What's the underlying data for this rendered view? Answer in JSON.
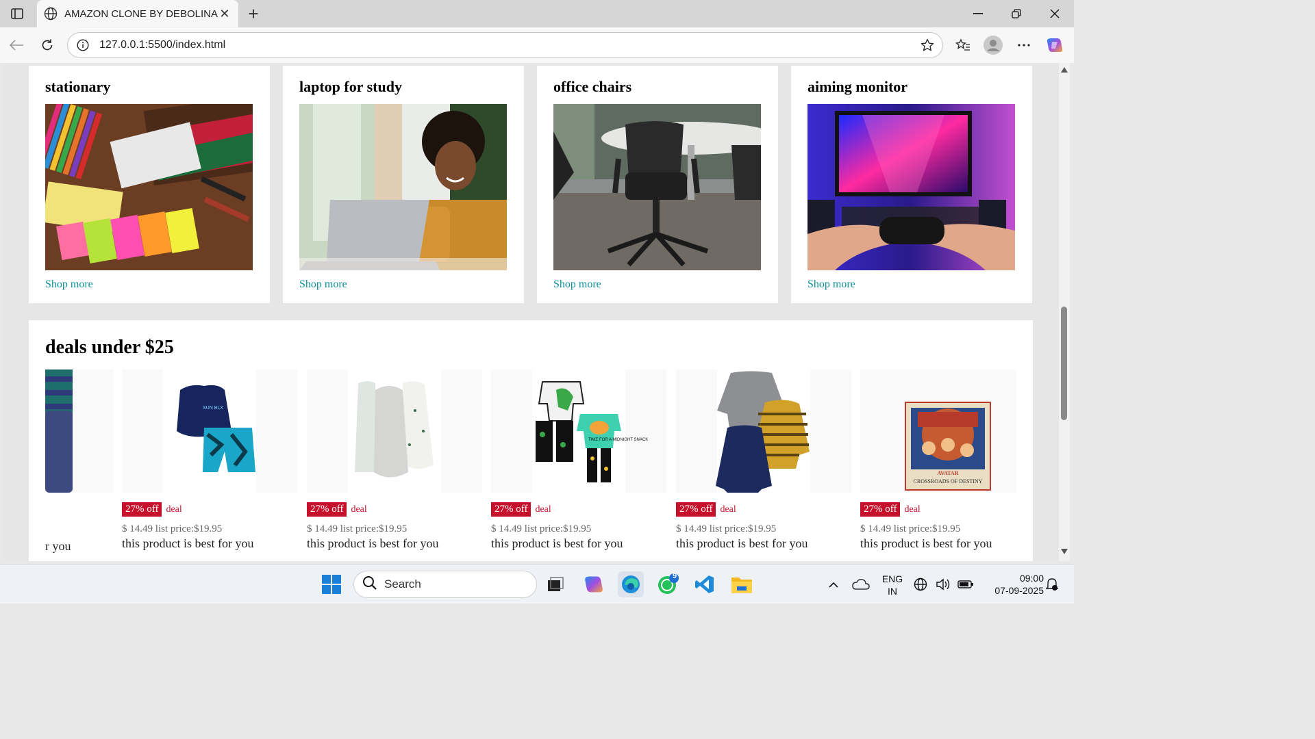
{
  "browser": {
    "tab_title": "AMAZON CLONE BY DEBOLINA",
    "url": "127.0.0.1:5500/index.html"
  },
  "cards": [
    {
      "title": "stationary",
      "link": "Shop more"
    },
    {
      "title": "laptop for study",
      "link": "Shop more"
    },
    {
      "title": "office chairs",
      "link": "Shop more"
    },
    {
      "title": "aiming monitor",
      "link": "Shop more"
    }
  ],
  "deals": {
    "heading": "deals under $25",
    "partial_desc": "r you",
    "items": [
      {
        "discount": "27% off",
        "tag": "deal",
        "price": "$ 14.49 list price:$19.95",
        "desc": "this product is best for you"
      },
      {
        "discount": "27% off",
        "tag": "deal",
        "price": "$ 14.49 list price:$19.95",
        "desc": "this product is best for you"
      },
      {
        "discount": "27% off",
        "tag": "deal",
        "price": "$ 14.49 list price:$19.95",
        "desc": "this product is best for you"
      },
      {
        "discount": "27% off",
        "tag": "deal",
        "price": "$ 14.49 list price:$19.95",
        "desc": "this product is best for you"
      },
      {
        "discount": "27% off",
        "tag": "deal",
        "price": "$ 14.49 list price:$19.95",
        "desc": "this product is best for you"
      }
    ],
    "product_text": {
      "sunblock": "SUN BLX",
      "snack": "TIME FOR A MIDNIGHT SNACK",
      "avatar": "AVATAR",
      "crossroads": "CROSSROADS OF DESTINY"
    }
  },
  "taskbar": {
    "search_label": "Search",
    "lang_line1": "ENG",
    "lang_line2": "IN",
    "time": "09:00",
    "date": "07-09-2025",
    "whatsapp_badge": "9"
  },
  "colors": {
    "accent_link": "#0f8f9b",
    "deal_red": "#c7102b"
  }
}
